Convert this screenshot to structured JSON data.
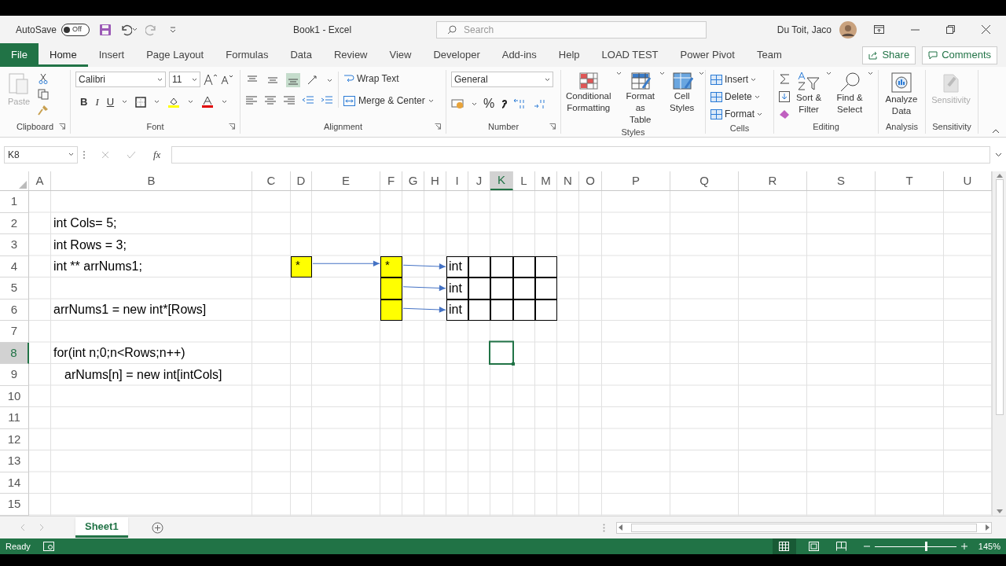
{
  "title_bar": {
    "autosave": {
      "label": "AutoSave",
      "state": "Off",
      "on": false
    },
    "title": "Book1  -  Excel",
    "search": {
      "placeholder": "Search"
    },
    "user": "Du Toit, Jaco"
  },
  "tabs": [
    {
      "label": "File",
      "kind": "file",
      "selected": false
    },
    {
      "label": "Home",
      "kind": "tab",
      "selected": true
    },
    {
      "label": "Insert",
      "kind": "tab",
      "selected": false
    },
    {
      "label": "Page Layout",
      "kind": "tab",
      "selected": false
    },
    {
      "label": "Formulas",
      "kind": "tab",
      "selected": false
    },
    {
      "label": "Data",
      "kind": "tab",
      "selected": false
    },
    {
      "label": "Review",
      "kind": "tab",
      "selected": false
    },
    {
      "label": "View",
      "kind": "tab",
      "selected": false
    },
    {
      "label": "Developer",
      "kind": "tab",
      "selected": false
    },
    {
      "label": "Add-ins",
      "kind": "tab",
      "selected": false
    },
    {
      "label": "Help",
      "kind": "tab",
      "selected": false
    },
    {
      "label": "LOAD TEST",
      "kind": "tab",
      "selected": false
    },
    {
      "label": "Power Pivot",
      "kind": "tab",
      "selected": false
    },
    {
      "label": "Team",
      "kind": "tab",
      "selected": false
    }
  ],
  "share": "Share",
  "comments": "Comments",
  "ribbon": {
    "groups": [
      {
        "label": "Clipboard",
        "items": [
          {
            "label": "Paste",
            "disabled": true
          }
        ]
      },
      {
        "label": "Font",
        "font": "Calibri",
        "size": "11",
        "styles": [
          "B",
          "I",
          "U"
        ]
      },
      {
        "label": "Alignment",
        "items": [
          {
            "label": "Wrap Text"
          },
          {
            "label": "Merge & Center"
          }
        ]
      },
      {
        "label": "Number",
        "format": "General",
        "symbols": [
          "%"
        ]
      },
      {
        "label": "Styles",
        "items": [
          {
            "label": "Conditional Formatting"
          },
          {
            "label": "Format as Table"
          },
          {
            "label": "Cell Styles"
          }
        ]
      },
      {
        "label": "Cells",
        "items": [
          {
            "label": "Insert"
          },
          {
            "label": "Delete"
          },
          {
            "label": "Format"
          }
        ]
      },
      {
        "label": "Editing",
        "items": [
          {
            "label": "Sort & Filter"
          },
          {
            "label": "Find & Select"
          }
        ]
      },
      {
        "label": "Analysis",
        "items": [
          {
            "label": "Analyze Data",
            "disabled": false
          }
        ]
      },
      {
        "label": "Sensitivity",
        "items": [
          {
            "label": "Sensitivity",
            "disabled": true
          }
        ]
      }
    ]
  },
  "formula_bar": {
    "name_box": "K8",
    "fx": "fx"
  },
  "columns": [
    {
      "label": "A",
      "selected": false
    },
    {
      "label": "B",
      "selected": false
    },
    {
      "label": "C",
      "selected": false
    },
    {
      "label": "D",
      "selected": false
    },
    {
      "label": "E",
      "selected": false
    },
    {
      "label": "F",
      "selected": false
    },
    {
      "label": "G",
      "selected": false
    },
    {
      "label": "H",
      "selected": false
    },
    {
      "label": "I",
      "selected": false
    },
    {
      "label": "J",
      "selected": false
    },
    {
      "label": "K",
      "selected": true
    },
    {
      "label": "L",
      "selected": false
    },
    {
      "label": "M",
      "selected": false
    },
    {
      "label": "N",
      "selected": false
    },
    {
      "label": "O",
      "selected": false
    },
    {
      "label": "P",
      "selected": false
    },
    {
      "label": "Q",
      "selected": false
    },
    {
      "label": "R",
      "selected": false
    },
    {
      "label": "S",
      "selected": false
    },
    {
      "label": "T",
      "selected": false
    },
    {
      "label": "U",
      "selected": false
    }
  ],
  "rows": [
    {
      "label": "1",
      "selected": false
    },
    {
      "label": "2",
      "selected": false,
      "entries": [
        {
          "kind": "code",
          "text": "int Cols= 5;"
        }
      ]
    },
    {
      "label": "3",
      "selected": false,
      "entries": [
        {
          "kind": "code",
          "text": "int Rows = 3;"
        }
      ]
    },
    {
      "label": "4",
      "selected": false,
      "entries": [
        {
          "kind": "code",
          "text": "int ** arrNums1;"
        },
        {
          "kind": "pointer",
          "text": "*"
        },
        {
          "kind": "array_slot",
          "text": "*"
        },
        {
          "kind": "int_row",
          "text": "int"
        }
      ]
    },
    {
      "label": "5",
      "selected": false,
      "entries": [
        {
          "kind": "array_slot"
        },
        {
          "kind": "int_row",
          "text": "int"
        }
      ]
    },
    {
      "label": "6",
      "selected": false,
      "entries": [
        {
          "kind": "code",
          "text": "arrNums1 = new int*[Rows]"
        },
        {
          "kind": "array_slot"
        },
        {
          "kind": "int_row",
          "text": "int"
        }
      ]
    },
    {
      "label": "7",
      "selected": false
    },
    {
      "label": "8",
      "selected": true,
      "entries": [
        {
          "kind": "code",
          "text": "for(int n;0;n<Rows;n++)"
        }
      ]
    },
    {
      "label": "9",
      "selected": false,
      "entries": [
        {
          "kind": "code_indented",
          "text": "arNums[n] = new int[intCols]"
        }
      ]
    },
    {
      "label": "10",
      "selected": false
    },
    {
      "label": "11",
      "selected": false
    },
    {
      "label": "12",
      "selected": false
    },
    {
      "label": "13",
      "selected": false
    },
    {
      "label": "14",
      "selected": false
    },
    {
      "label": "15",
      "selected": false
    }
  ],
  "sheet_tabs": [
    {
      "label": "Sheet1",
      "selected": true
    }
  ],
  "status_bar": {
    "status": "Ready",
    "zoom": "145%",
    "zoom_slider": {
      "level": 0.62
    }
  }
}
